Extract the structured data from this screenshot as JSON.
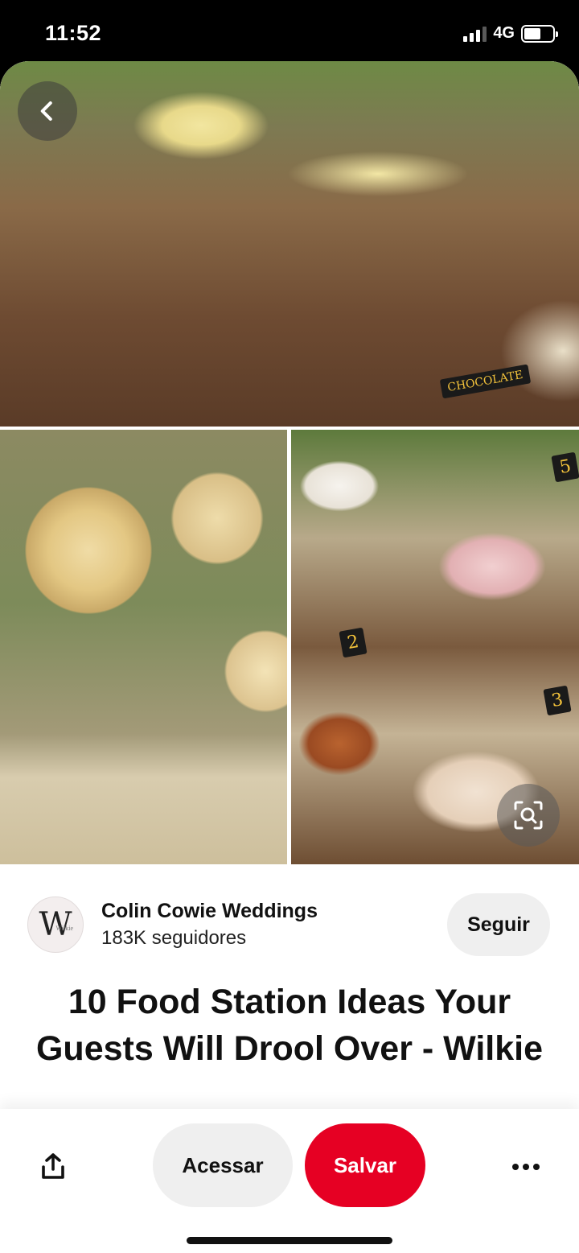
{
  "status_bar": {
    "time": "11:52",
    "network": "4G",
    "battery_level": 0.6,
    "signal_icon": "signal-bars-icon",
    "battery_icon": "battery-icon"
  },
  "collage": {
    "back_icon": "chevron-left-icon",
    "lens_icon": "visual-search-icon",
    "photo_labels": [
      "CHOCOLATE",
      "5",
      "2",
      "3"
    ]
  },
  "creator": {
    "avatar_letter": "W",
    "avatar_sub": "Wilkie",
    "name": "Colin Cowie Weddings",
    "followers": "183K seguidores",
    "follow_label": "Seguir"
  },
  "pin": {
    "title": "10 Food Station Ideas Your Guests Will Drool Over - Wilkie"
  },
  "actions": {
    "share_icon": "share-icon",
    "visit_label": "Acessar",
    "save_label": "Salvar",
    "more_icon": "more-dots-icon"
  },
  "colors": {
    "save_button": "#e60023",
    "secondary_button": "#efefef",
    "text": "#111111"
  }
}
